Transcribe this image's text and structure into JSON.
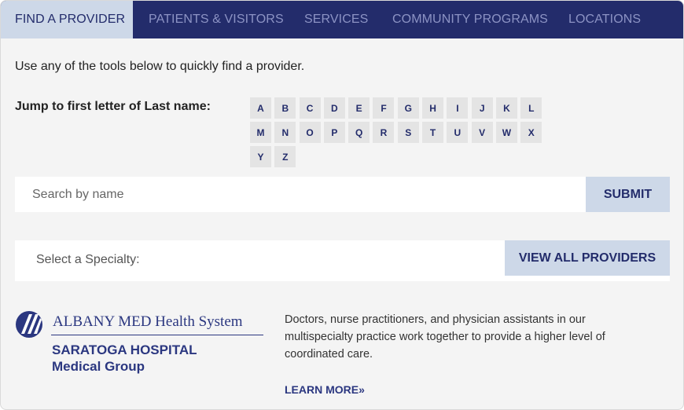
{
  "nav": {
    "tabs": [
      {
        "label": "FIND A PROVIDER",
        "active": true
      },
      {
        "label": "PATIENTS & VISITORS"
      },
      {
        "label": "SERVICES"
      },
      {
        "label": "COMMUNITY PROGRAMS"
      },
      {
        "label": "LOCATIONS"
      }
    ]
  },
  "intro": "Use any of the tools below to quickly find a provider.",
  "jump": {
    "label": "Jump to first letter of Last name:",
    "letters": [
      "A",
      "B",
      "C",
      "D",
      "E",
      "F",
      "G",
      "H",
      "I",
      "J",
      "K",
      "L",
      "M",
      "N",
      "O",
      "P",
      "Q",
      "R",
      "S",
      "T",
      "U",
      "V",
      "W",
      "X",
      "Y",
      "Z"
    ]
  },
  "search": {
    "placeholder": "Search by name",
    "submit_label": "SUBMIT"
  },
  "specialty": {
    "selected": "Select a Specialty:",
    "view_all_label": "VIEW ALL PROVIDERS"
  },
  "logo": {
    "name": "ALBANY MED Health System",
    "sub1": "SARATOGA HOSPITAL",
    "sub2": "Medical Group"
  },
  "description": "Doctors, nurse practitioners, and physician assistants in our multispecialty practice work together to provide a higher level of coordinated care.",
  "learn_more": "LEARN MORE»",
  "colors": {
    "nav_bg": "#232c6b",
    "nav_text": "#8c93c4",
    "active_tab_bg": "#cdd8e8",
    "brand": "#2b3780",
    "page_bg": "#f4f4f4"
  }
}
